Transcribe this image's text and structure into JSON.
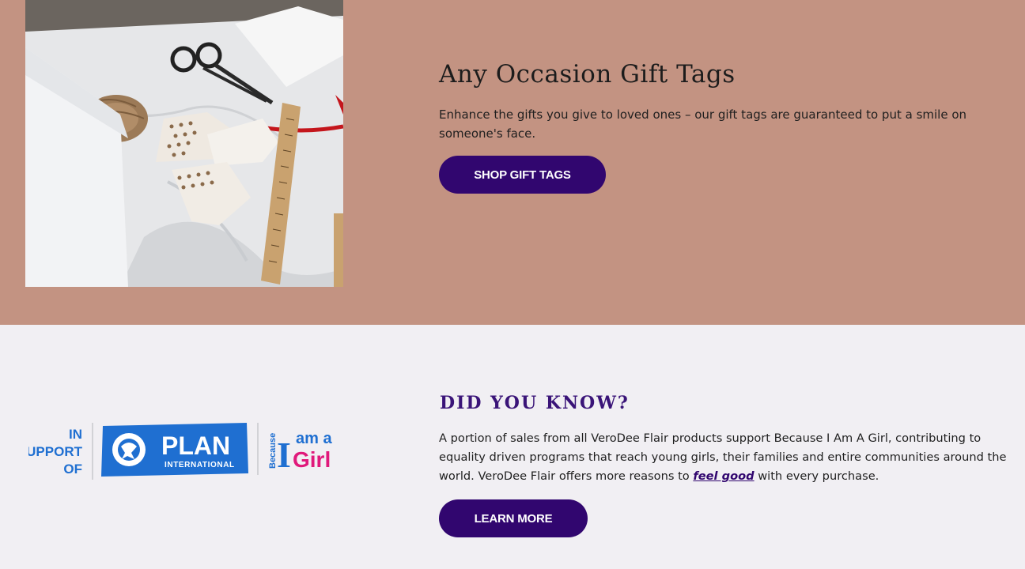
{
  "gift_tags": {
    "title": "Any Occasion Gift Tags",
    "description": "Enhance the gifts you give to loved ones – our gift tags are guaranteed to put a smile on someone's face.",
    "button_label": "SHOP GIFT TAGS",
    "image_icon": "gift-tags-photo"
  },
  "did_you_know": {
    "title": "DID YOU KNOW?",
    "description_before_link": "A portion of sales from all VeroDee Flair products support Because I Am A Girl, contributing to equality driven programs that reach young girls, their families and entire communities around the world. VeroDee Flair offers more reasons to ",
    "link_text": "feel good",
    "description_after_link": " with every purchase.",
    "button_label": "LEARN MORE"
  },
  "logo": {
    "in_support_line1": "IN",
    "in_support_line2": "SUPPORT",
    "in_support_line3": "OF",
    "plan_text": "PLAN",
    "plan_sub": "INTERNATIONAL",
    "because": "Because",
    "i_letter": "I",
    "am_a": "am a",
    "girl": "Girl"
  },
  "colors": {
    "top_background": "#c39382",
    "bottom_background": "#f1eff3",
    "button": "#31066f",
    "plan_blue": "#1f6fd1",
    "girl_pink": "#e0197b"
  }
}
